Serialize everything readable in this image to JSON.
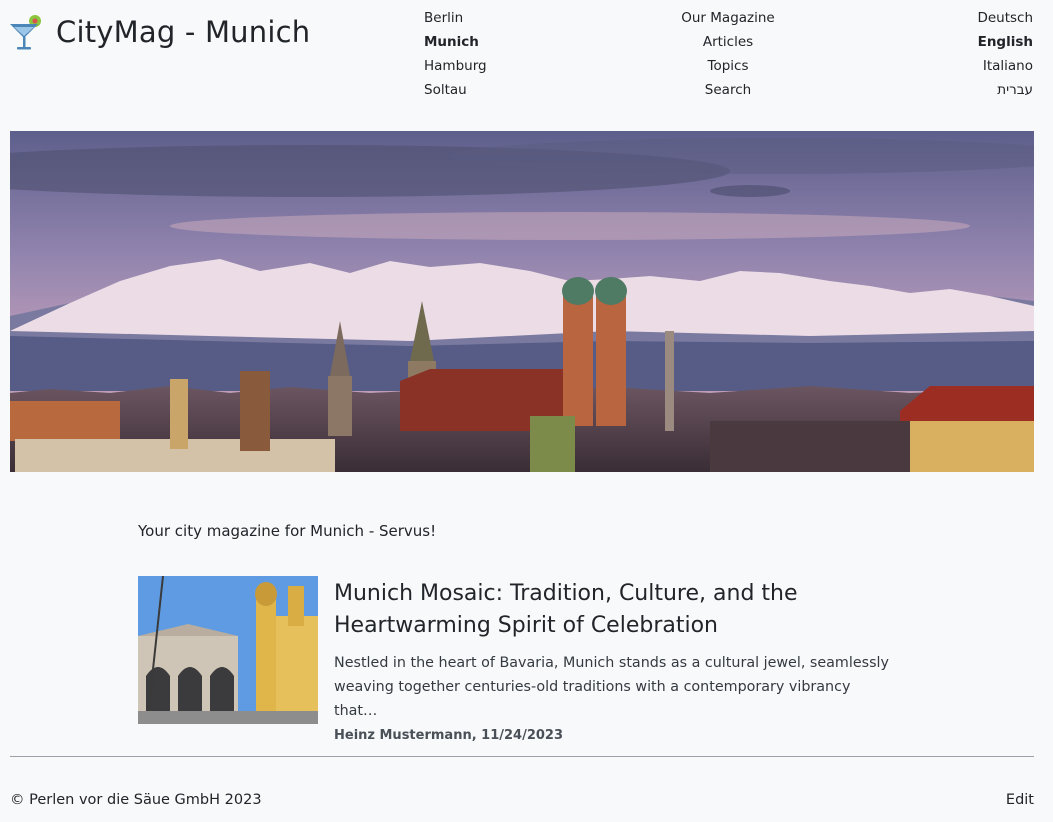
{
  "brand": {
    "title": "CityMag - Munich",
    "icon": "cocktail-glass-icon",
    "colors": {
      "glass": "#4a86b8",
      "olive": "#8cc63f"
    }
  },
  "nav": {
    "cities": [
      {
        "label": "Berlin",
        "active": false
      },
      {
        "label": "Munich",
        "active": true
      },
      {
        "label": "Hamburg",
        "active": false
      },
      {
        "label": "Soltau",
        "active": false
      }
    ],
    "magazine": [
      {
        "label": "Our Magazine"
      },
      {
        "label": "Articles"
      },
      {
        "label": "Topics"
      },
      {
        "label": "Search"
      }
    ],
    "languages": [
      {
        "label": "Deutsch",
        "active": false
      },
      {
        "label": "English",
        "active": true
      },
      {
        "label": "Italiano",
        "active": false
      },
      {
        "label": "עברית",
        "active": false
      }
    ]
  },
  "hero": {
    "subject": "munich-skyline-with-alps"
  },
  "tagline": "Your city magazine for Munich - Servus!",
  "article": {
    "title": "Munich Mosaic: Tradition, Culture, and the Heartwarming Spirit of Celebration",
    "excerpt": "Nestled in the heart of Bavaria, Munich stands as a cultural jewel, seamlessly weaving together centuries-old traditions with a contemporary vibrancy that…",
    "meta": "Heinz Mustermann, 11/24/2023",
    "thumbnail": "odeonsplatz-theatinerkirche-photo"
  },
  "footer": {
    "copyright": "© Perlen vor die Säue GmbH 2023",
    "edit_label": "Edit"
  }
}
